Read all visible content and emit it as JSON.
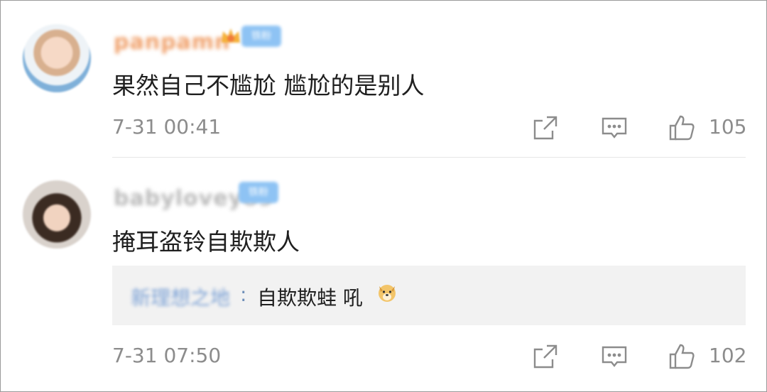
{
  "comments": [
    {
      "username": "panpamn",
      "badge": "铁粉",
      "text": "果然自己不尴尬 尴尬的是别人",
      "time": "7-31 00:41",
      "likes": "105",
      "icons": [
        "share-icon",
        "reply-icon",
        "like-icon"
      ]
    },
    {
      "username": "babyloveyo9",
      "badge": "铁粉",
      "text": "掩耳盗铃自欺欺人",
      "reply": {
        "user": "新理想之地",
        "colon": ":",
        "text": "自欺欺蛙 吼",
        "emoji": "doge-emoji"
      },
      "time": "7-31 07:50",
      "likes": "102",
      "icons": [
        "share-icon",
        "reply-icon",
        "like-icon"
      ]
    }
  ],
  "colors": {
    "username_orange": "#f0a06a",
    "badge_blue": "#8ec3f4",
    "meta_gray": "#8c8c8c",
    "reply_bg": "#f2f2f2"
  }
}
